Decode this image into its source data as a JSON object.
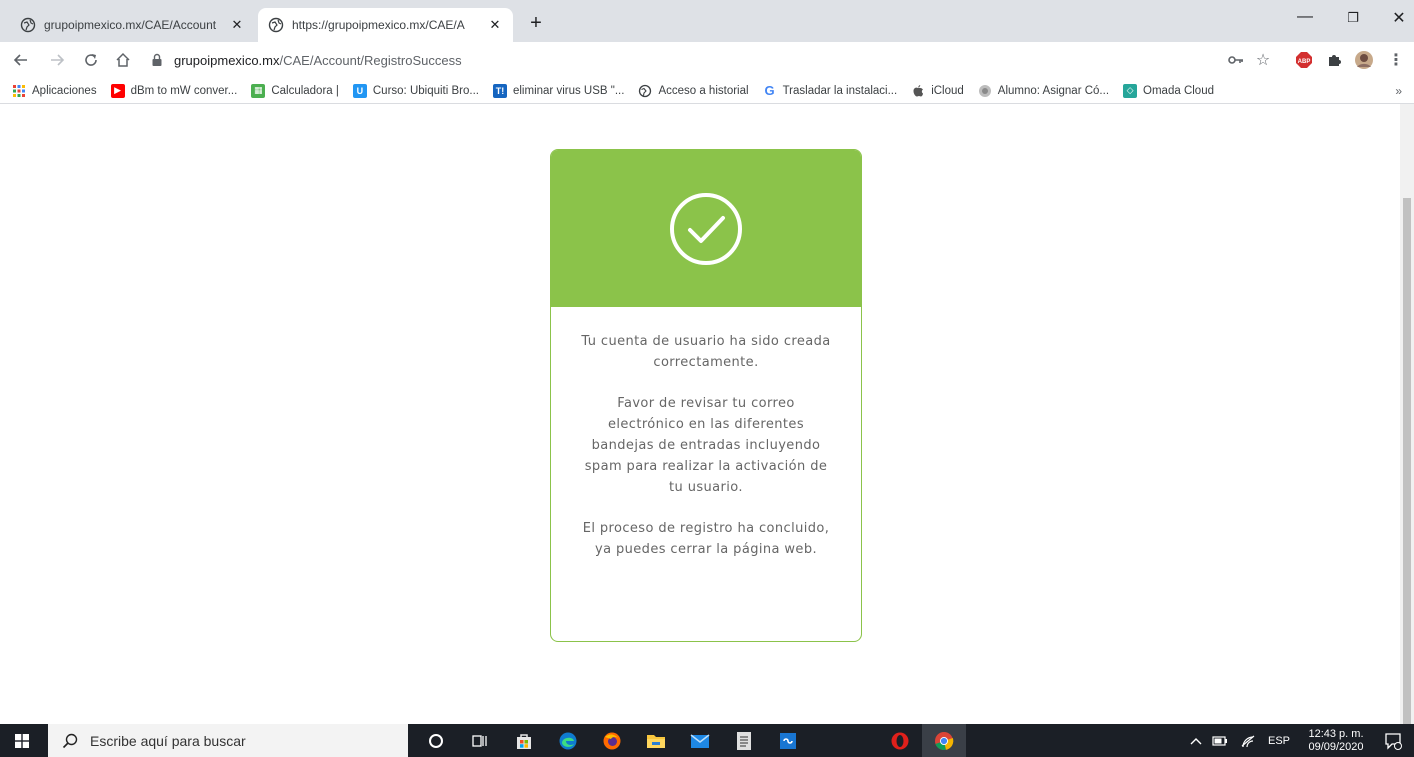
{
  "tabs": [
    {
      "title": "grupoipmexico.mx/CAE/Account",
      "active": false
    },
    {
      "title": "https://grupoipmexico.mx/CAE/A",
      "active": true
    }
  ],
  "window_controls": {
    "minimize": "—",
    "maximize": "❐",
    "close": "✕"
  },
  "address_bar": {
    "host": "grupoipmexico.mx",
    "path": "/CAE/Account/RegistroSuccess"
  },
  "bookmarks": [
    {
      "label": "Aplicaciones",
      "icon": "apps-grid-icon",
      "color": "#4285f4"
    },
    {
      "label": "dBm to mW conver...",
      "icon": "youtube-icon",
      "color": "#ff0000"
    },
    {
      "label": "Calculadora |",
      "icon": "calculator-icon",
      "color": "#4caf50"
    },
    {
      "label": "Curso: Ubiquiti Bro...",
      "icon": "udemy-icon",
      "color": "#2196f3"
    },
    {
      "label": "eliminar virus USB \"...",
      "icon": "tutorial-icon",
      "color": "#1565c0"
    },
    {
      "label": "Acceso a historial",
      "icon": "globe-icon",
      "color": "#5f6368"
    },
    {
      "label": "Trasladar la instalaci...",
      "icon": "google-icon",
      "color": "#4285f4"
    },
    {
      "label": "iCloud",
      "icon": "apple-icon",
      "color": "#555555"
    },
    {
      "label": "Alumno: Asignar Có...",
      "icon": "moodle-icon",
      "color": "#9e9e9e"
    },
    {
      "label": "Omada Cloud",
      "icon": "omada-icon",
      "color": "#26a69a"
    }
  ],
  "bookmarks_more": "»",
  "card": {
    "header_color": "#8bc34a",
    "icon": "check-circle-icon",
    "paragraphs": [
      "Tu cuenta de usuario ha sido creada correctamente.",
      "Favor de revisar tu correo electrónico en las diferentes bandejas de entradas incluyendo spam para realizar la activación de tu usuario.",
      "El proceso de registro ha concluido, ya puedes cerrar la página web."
    ]
  },
  "taskbar": {
    "search_placeholder": "Escribe aquí para buscar",
    "language": "ESP",
    "time": "12:43 p. m.",
    "date": "09/09/2020"
  }
}
